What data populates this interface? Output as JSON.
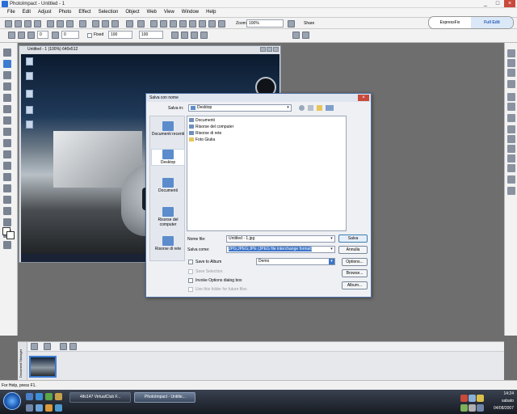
{
  "window": {
    "title": "PhotoImpact - Untitled - 1",
    "controls": [
      "_",
      "□",
      "×"
    ]
  },
  "menu": [
    "File",
    "Edit",
    "Adjust",
    "Photo",
    "Effect",
    "Selection",
    "Object",
    "Web",
    "View",
    "Window",
    "Help"
  ],
  "mode_switch": {
    "expressfix": "ExpressFix",
    "full_edit": "Full Edit"
  },
  "toolbar": {
    "zoom_label": "Zoom",
    "zoom_value": "100%",
    "share_label": "Share",
    "fixed_label": "Fixed",
    "width_value": "100",
    "height_value": "100",
    "brush_value": "0"
  },
  "image_window": {
    "title": "Untitled - 1 (100%) 640x512"
  },
  "save_dialog": {
    "title": "Salva con nome",
    "save_in_label": "Salva in:",
    "save_in_value": "Desktop",
    "places": [
      "Documenti recenti",
      "Desktop",
      "Documenti",
      "Risorse del computer",
      "Risorse di rete"
    ],
    "files": [
      {
        "name": "Documenti",
        "folder": false
      },
      {
        "name": "Risorse del computer",
        "folder": false
      },
      {
        "name": "Risorse di rete",
        "folder": false
      },
      {
        "name": "Foto Giulia",
        "folder": true
      }
    ],
    "filename_label": "Nome file:",
    "filename_value": "Untitled - 1.jpg",
    "type_label": "Salva come:",
    "type_value": "JPG;JPEG;JPE (JPEG file interchange format)",
    "save_to_album_label": "Save to Album",
    "album_value": "Demo",
    "save_selection_label": "Save Selection",
    "invoke_options_label": "Invoke Options dialog box",
    "use_folder_label": "Use this folder for future files",
    "btn_save": "Salva",
    "btn_cancel": "Annulla",
    "btn_options": "Options...",
    "btn_browse": "Browse...",
    "btn_album": "Album..."
  },
  "filmstrip": {
    "side_label": "Document Manager"
  },
  "status": {
    "text": "For Help, press F1."
  },
  "taskbar": {
    "buttons": [
      "4ifo147 VirtualClub F...",
      "PhotoImpact - Untitle..."
    ],
    "clock_time": "14:24",
    "clock_day": "sabato",
    "clock_date": "04/08/2007"
  }
}
